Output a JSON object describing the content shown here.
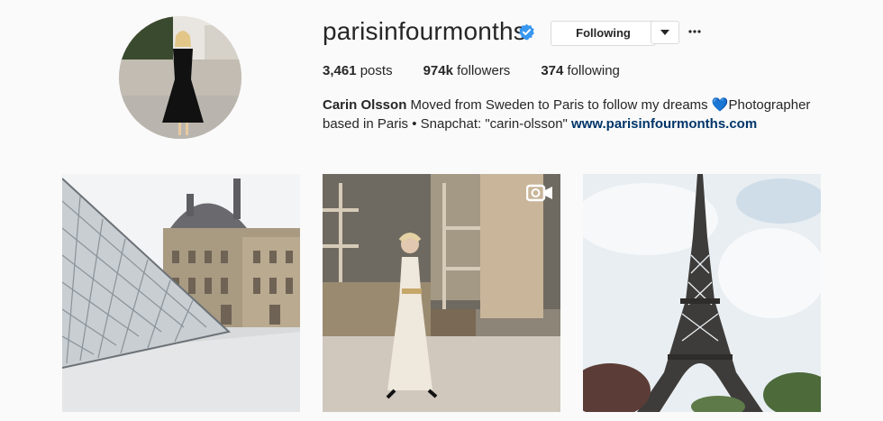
{
  "profile": {
    "username": "parisinfourmonths",
    "verified": true,
    "follow_button_label": "Following",
    "stats": {
      "posts_count": "3,461",
      "posts_label": "posts",
      "followers_count": "974k",
      "followers_label": "followers",
      "following_count": "374",
      "following_label": "following"
    },
    "bio": {
      "full_name": "Carin Olsson",
      "text_line1": "Moved from Sweden to Paris to follow my dreams 💙Photographer",
      "text_line2": "based in Paris • Snapchat: \"carin-olsson\"",
      "website": "www.parisinfourmonths.com"
    },
    "icons": {
      "verified": "verified-badge-icon",
      "dropdown": "chevron-down-icon",
      "more": "more-options-icon"
    }
  },
  "posts": [
    {
      "subject": "louvre-pyramid-photo",
      "is_video": false
    },
    {
      "subject": "runway-model-photo",
      "is_video": true
    },
    {
      "subject": "eiffel-tower-photo",
      "is_video": false
    }
  ],
  "colors": {
    "background": "#fafafa",
    "text": "#262626",
    "link": "#003569",
    "verified": "#3897f0",
    "border": "#dbdbdb"
  }
}
